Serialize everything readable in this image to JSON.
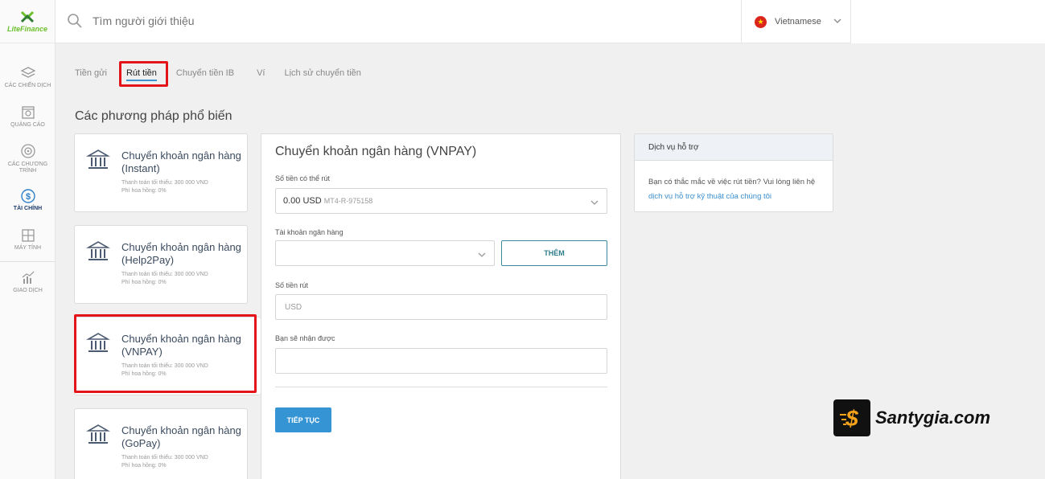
{
  "brand": {
    "name": "LiteFinance",
    "accent": "#6cbf2b"
  },
  "search": {
    "placeholder": "Tìm người giới thiệu"
  },
  "language": {
    "label": "Vietnamese"
  },
  "sidebar": {
    "items": [
      {
        "label": "CÁC CHIẾN DỊCH",
        "icon": "layers-icon"
      },
      {
        "label": "QUẢNG CÁO",
        "icon": "ad-icon"
      },
      {
        "label": "CÁC CHƯƠNG TRÌNH",
        "icon": "target-icon"
      },
      {
        "label": "TÀI CHÍNH",
        "icon": "dollar-icon",
        "active": true
      },
      {
        "label": "MÁY TÍNH",
        "icon": "calculator-icon"
      },
      {
        "label": "GIAO DỊCH",
        "icon": "chart-icon"
      }
    ]
  },
  "tabs": [
    {
      "label": "Tiền gửi"
    },
    {
      "label": "Rút tiền",
      "active": true
    },
    {
      "label": "Chuyển tiền IB"
    },
    {
      "label": "Ví"
    },
    {
      "label": "Lịch sử chuyển tiền"
    }
  ],
  "section_title": "Các phương pháp phổ biến",
  "methods": [
    {
      "title": "Chuyển khoản ngân hàng (Instant)",
      "min": "Thanh toán tối thiểu: 300 000 VND",
      "fee": "Phí hoa hồng: 0%"
    },
    {
      "title": "Chuyển khoản ngân hàng (Help2Pay)",
      "min": "Thanh toán tối thiểu: 300 000 VND",
      "fee": "Phí hoa hồng: 0%"
    },
    {
      "title": "Chuyển khoản ngân hàng (VNPAY)",
      "min": "Thanh toán tối thiểu: 300 000 VND",
      "fee": "Phí hoa hồng: 0%",
      "selected": true
    },
    {
      "title": "Chuyển khoản ngân hàng (GoPay)",
      "min": "Thanh toán tối thiểu: 300 000 VND",
      "fee": "Phí hoa hồng: 0%"
    }
  ],
  "form": {
    "title": "Chuyển khoản ngân hàng (VNPAY)",
    "available_label": "Số tiền có thể rút",
    "available_value": "0.00 USD",
    "available_account": "MT4-R-975158",
    "bank_account_label": "Tài khoản ngân hàng",
    "bank_account_value": "",
    "add_button": "THÊM",
    "amount_label": "Số tiền rút",
    "amount_placeholder": "USD",
    "receive_label": "Bạn sẽ nhận được",
    "receive_value": "",
    "continue_button": "TIẾP TỤC"
  },
  "support": {
    "title": "Dịch vụ hỗ trợ",
    "text": "Bạn có thắc mắc về việc rút tiền? Vui lòng liên hệ",
    "link": "dịch vụ hỗ trợ kỹ thuật của chúng tôi"
  },
  "watermark": {
    "text": "Santygia.com"
  },
  "colors": {
    "highlight_box": "#e3141a",
    "primary_button": "#3594d4",
    "tab_underline": "#3a94d0"
  }
}
